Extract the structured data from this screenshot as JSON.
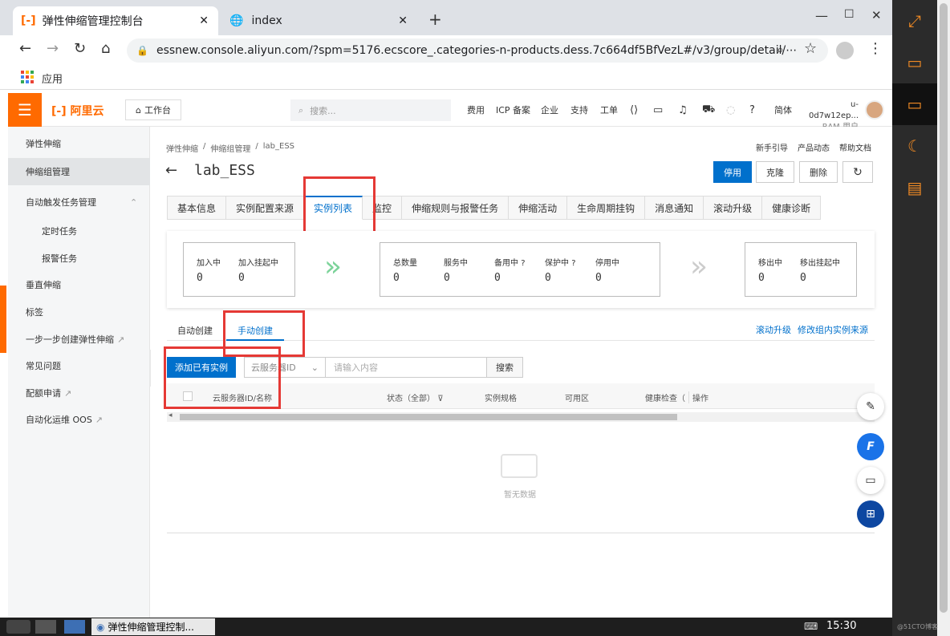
{
  "browser": {
    "tabs": [
      {
        "title": "弹性伸缩管理控制台",
        "active": true
      },
      {
        "title": "index",
        "active": false
      }
    ],
    "url": "essnew.console.aliyun.com/?spm=5176.ecscore_.categories-n-products.dess.7c664df5BfVezL#/v3/group/detail/⋯",
    "bookmark_apps": "应用"
  },
  "header": {
    "logo": "阿里云",
    "workbench": "工作台",
    "search_placeholder": "搜索...",
    "nav": [
      "费用",
      "ICP 备案",
      "企业",
      "支持",
      "工单"
    ],
    "lang": "简体",
    "user": "u-0d7w12ep...",
    "user_role": "RAM 用户"
  },
  "sidebar": {
    "items": [
      {
        "label": "弹性伸缩",
        "level": 0
      },
      {
        "label": "伸缩组管理",
        "level": 0,
        "active": true
      },
      {
        "label": "自动触发任务管理",
        "level": 0,
        "expandable": true
      },
      {
        "label": "定时任务",
        "level": 1
      },
      {
        "label": "报警任务",
        "level": 1
      },
      {
        "label": "垂直伸缩",
        "level": 0
      },
      {
        "label": "标签",
        "level": 0
      },
      {
        "label": "一步一步创建弹性伸缩",
        "level": 0,
        "external": true
      },
      {
        "label": "常见问题",
        "level": 0
      },
      {
        "label": "配额申请",
        "level": 0,
        "external": true
      },
      {
        "label": "自动化运维 OOS",
        "level": 0,
        "external": true
      }
    ]
  },
  "breadcrumb": [
    "弹性伸缩",
    "伸缩组管理",
    "lab_ESS"
  ],
  "top_links": [
    "新手引导",
    "产品动态",
    "帮助文档"
  ],
  "page_title": "lab_ESS",
  "actions": {
    "disable": "停用",
    "clone": "克隆",
    "delete": "删除"
  },
  "tabs": [
    "基本信息",
    "实例配置来源",
    "实例列表",
    "监控",
    "伸缩规则与报警任务",
    "伸缩活动",
    "生命周期挂钩",
    "消息通知",
    "滚动升级",
    "健康诊断"
  ],
  "active_tab": "实例列表",
  "stats": {
    "group1": [
      {
        "label": "加入中",
        "value": "0"
      },
      {
        "label": "加入挂起中",
        "value": "0"
      }
    ],
    "group2": [
      {
        "label": "总数量",
        "value": "0"
      },
      {
        "label": "服务中",
        "value": "0"
      },
      {
        "label": "备用中",
        "value": "0",
        "help": true
      },
      {
        "label": "保护中",
        "value": "0",
        "help": true
      },
      {
        "label": "停用中",
        "value": "0"
      }
    ],
    "group3": [
      {
        "label": "移出中",
        "value": "0"
      },
      {
        "label": "移出挂起中",
        "value": "0"
      }
    ]
  },
  "subtabs": [
    "自动创建",
    "手动创建"
  ],
  "active_subtab": "手动创建",
  "right_links": [
    "滚动升级",
    "修改组内实例来源"
  ],
  "filter": {
    "add_button": "添加已有实例",
    "select_value": "云服务器ID",
    "input_placeholder": "请输入内容",
    "search_button": "搜索"
  },
  "table": {
    "columns": [
      "云服务器ID/名称",
      "状态（全部）",
      "实例规格",
      "可用区",
      "健康检查（",
      "操作"
    ],
    "empty_text": "暂无数据"
  },
  "taskbar": {
    "window": "弹性伸缩管理控制...",
    "time": "15:30",
    "watermark": "@51CTO博客"
  },
  "colors": {
    "accent": "#ff6a00",
    "primary": "#0070cc",
    "highlight": "#e53935"
  }
}
